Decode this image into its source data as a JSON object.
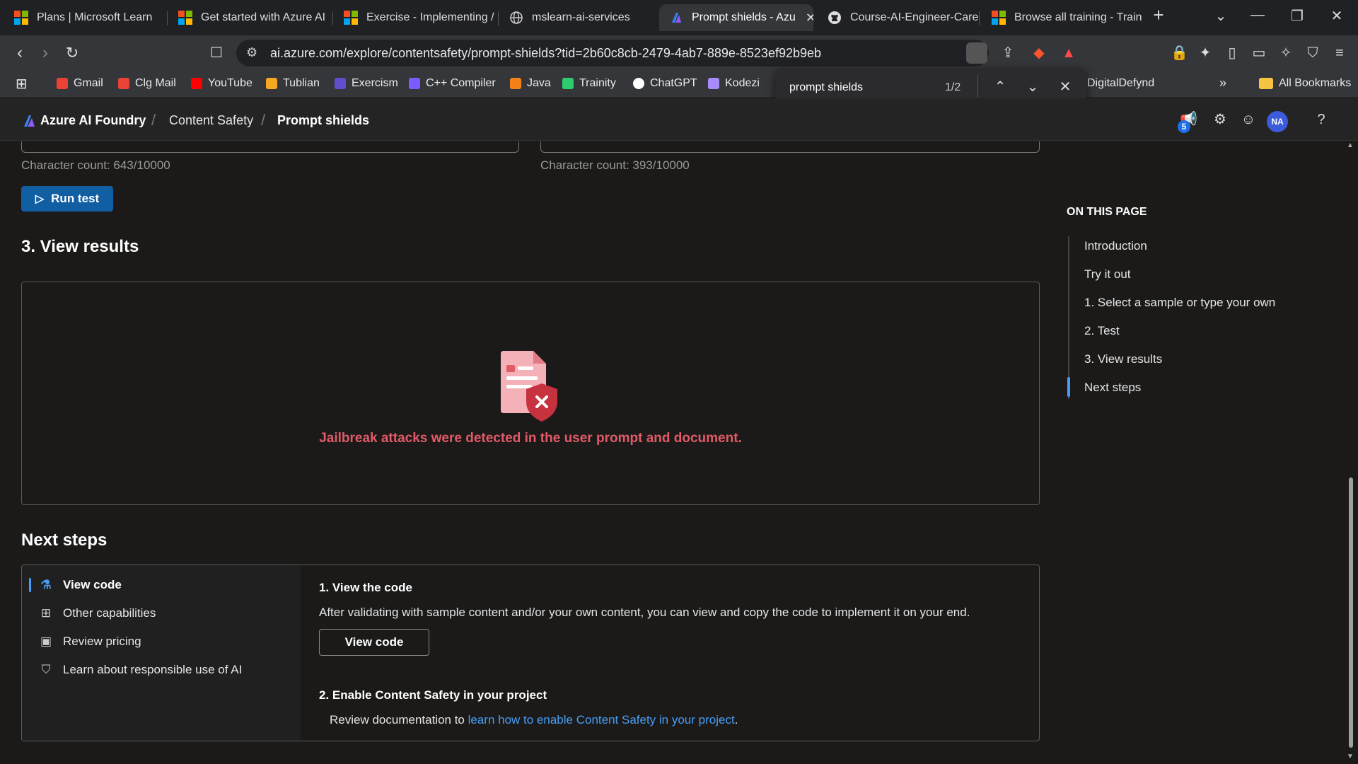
{
  "browser": {
    "tabs": [
      {
        "title": "Plans | Microsoft Learn",
        "icon": "microsoft-icon"
      },
      {
        "title": "Get started with Azure AI",
        "icon": "microsoft-icon"
      },
      {
        "title": "Exercise - Implementing /",
        "icon": "microsoft-icon"
      },
      {
        "title": "mslearn-ai-services",
        "icon": "globe-icon"
      },
      {
        "title": "Prompt shields - Azu",
        "icon": "azure-foundry-icon",
        "active": true
      },
      {
        "title": "Course-AI-Engineer-Care",
        "icon": "github-icon"
      },
      {
        "title": "Browse all training - Train",
        "icon": "microsoft-icon"
      }
    ],
    "url": "ai.azure.com/explore/contentsafety/prompt-shields?tid=2b60c8cb-2479-4ab7-889e-8523ef92b9eb",
    "bookmarks": [
      {
        "label": "Gmail",
        "color": "#ea4335"
      },
      {
        "label": "Clg Mail",
        "color": "#ea4335"
      },
      {
        "label": "YouTube",
        "color": "#ff0000"
      },
      {
        "label": "Tublian",
        "color": "#f5a623"
      },
      {
        "label": "Exercism",
        "color": "#604fcd"
      },
      {
        "label": "C++ Compiler",
        "color": "#7b5cff"
      },
      {
        "label": "Java",
        "color": "#f58219"
      },
      {
        "label": "Trainity",
        "color": "#2ecc71"
      },
      {
        "label": "ChatGPT",
        "color": "#ffffff"
      },
      {
        "label": "Kodezi",
        "color": "#a78bfa"
      },
      {
        "label": "DigitalDefynd",
        "color": "#999999"
      }
    ],
    "all_bookmarks": "All Bookmarks",
    "find": {
      "query": "prompt shields",
      "count": "1/2"
    }
  },
  "app": {
    "brand": "Azure AI Foundry",
    "breadcrumb": [
      "Content Safety",
      "Prompt shields"
    ],
    "notification_count": "5",
    "avatar_initials": "NA"
  },
  "main": {
    "char_count_left": "Character count: 643/10000",
    "char_count_right": "Character count: 393/10000",
    "run_test": "Run test",
    "view_results_heading": "3. View results",
    "result_message": "Jailbreak attacks were detected in the user prompt and document.",
    "next_steps_heading": "Next steps",
    "next_steps_nav": [
      {
        "label": "View code",
        "icon": "flask-icon"
      },
      {
        "label": "Other capabilities",
        "icon": "grid-add-icon"
      },
      {
        "label": "Review pricing",
        "icon": "money-icon"
      },
      {
        "label": "Learn about responsible use of AI",
        "icon": "shield-icon"
      }
    ],
    "step1_title": "1. View the code",
    "step1_text": "After validating with sample content and/or your own content, you can view and copy the code to implement it on your end.",
    "view_code_button": "View code",
    "step2_title": "2. Enable Content Safety in your project",
    "step2_prefix": "Review documentation to ",
    "step2_link": "learn how to enable Content Safety in your project",
    "step2_suffix": "."
  },
  "toc": {
    "title": "ON THIS PAGE",
    "items": [
      "Introduction",
      "Try it out",
      "1. Select a sample or type your own",
      "2. Test",
      "3. View results",
      "Next steps"
    ],
    "active_index": 5
  },
  "colors": {
    "accent": "#479ef5",
    "primary_button": "#115ea3",
    "error_text": "#e05a67"
  }
}
